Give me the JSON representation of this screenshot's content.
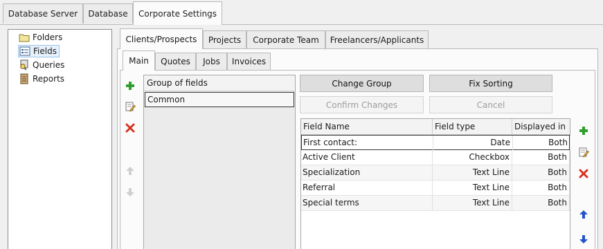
{
  "top_tabs": [
    "Database Server",
    "Database",
    "Corporate Settings"
  ],
  "tree": [
    {
      "label": "Folders",
      "icon": "folder-icon"
    },
    {
      "label": "Fields",
      "icon": "fields-icon"
    },
    {
      "label": "Queries",
      "icon": "queries-icon"
    },
    {
      "label": "Reports",
      "icon": "reports-icon"
    }
  ],
  "sub_tabs": [
    "Clients/Prospects",
    "Projects",
    "Corporate Team",
    "Freelancers/Applicants"
  ],
  "inner_tabs": [
    "Main",
    "Quotes",
    "Jobs",
    "Invoices"
  ],
  "groups": {
    "header": "Group of fields",
    "rows": [
      "Common"
    ]
  },
  "buttons": {
    "change_group": "Change Group",
    "fix_sorting": "Fix Sorting",
    "confirm_changes": "Confirm Changes",
    "cancel": "Cancel"
  },
  "fields_grid": {
    "columns": [
      "Field Name",
      "Field type",
      "Displayed in"
    ],
    "rows": [
      [
        "First contact:",
        "Date",
        "Both"
      ],
      [
        "Active Client",
        "Checkbox",
        "Both"
      ],
      [
        "Specialization",
        "Text Line",
        "Both"
      ],
      [
        "Referral",
        "Text Line",
        "Both"
      ],
      [
        "Special terms",
        "Text Line",
        "Both"
      ]
    ]
  },
  "colors": {
    "add": "#2e9e2e",
    "delete": "#d9321f",
    "arrow_disabled": "#9a9a9a",
    "arrow_active": "#2453c9"
  }
}
